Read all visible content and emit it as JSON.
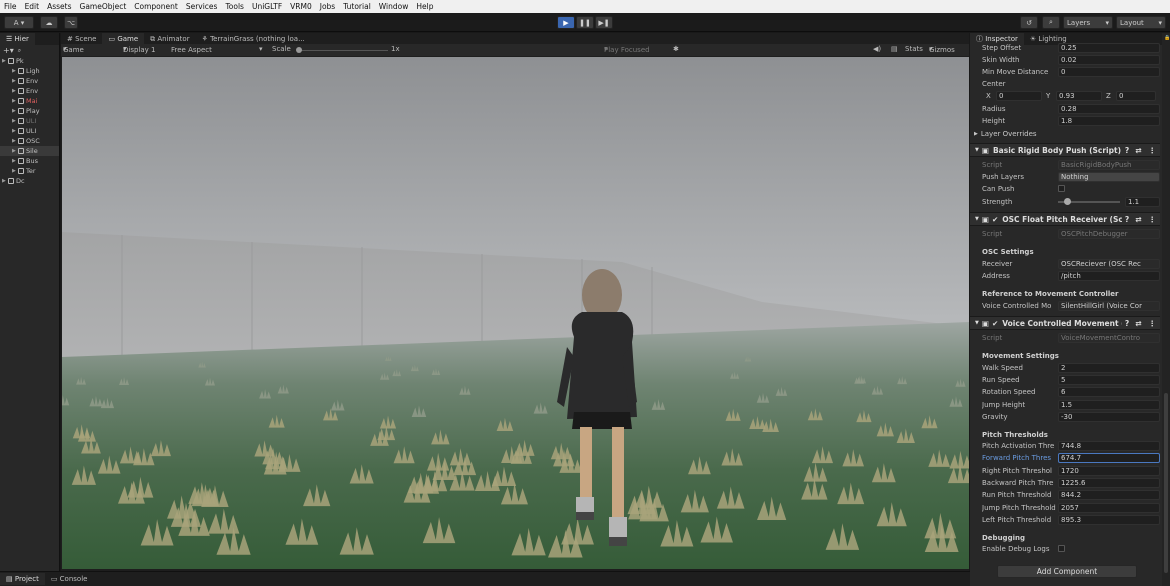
{
  "menu": [
    "File",
    "Edit",
    "Assets",
    "GameObject",
    "Component",
    "Services",
    "Tools",
    "UniGLTF",
    "VRM0",
    "Jobs",
    "Tutorial",
    "Window",
    "Help"
  ],
  "toolbar": {
    "account": "A ▾",
    "layers": "Layers",
    "layout": "Layout"
  },
  "hierarchy": {
    "tab": "Hier",
    "items": [
      {
        "label": "Pk",
        "indent": 0,
        "style": "normal"
      },
      {
        "label": "Ligh",
        "indent": 1,
        "style": "normal"
      },
      {
        "label": "Env",
        "indent": 1,
        "style": "normal"
      },
      {
        "label": "Env",
        "indent": 1,
        "style": "normal"
      },
      {
        "label": "Mai",
        "indent": 1,
        "style": "red"
      },
      {
        "label": "Play",
        "indent": 1,
        "style": "normal"
      },
      {
        "label": "ULI",
        "indent": 1,
        "style": "dim"
      },
      {
        "label": "ULI",
        "indent": 1,
        "style": "normal"
      },
      {
        "label": "OSC",
        "indent": 1,
        "style": "normal"
      },
      {
        "label": "Sile",
        "indent": 1,
        "style": "hl"
      },
      {
        "label": "Bus",
        "indent": 1,
        "style": "normal"
      },
      {
        "label": "Ter",
        "indent": 1,
        "style": "normal"
      },
      {
        "label": "Dc",
        "indent": 0,
        "style": "normal"
      }
    ]
  },
  "center_tabs": [
    "Scene",
    "Game",
    "Animator",
    "TerrainGrass (nothing loa..."
  ],
  "gamebar": {
    "mode": "Game",
    "display": "Display 1",
    "aspect": "Free Aspect",
    "scale_label": "Scale",
    "scale_value": "1x",
    "play_focused": "Play Focused",
    "stats": "Stats",
    "gizmos": "Gizmos"
  },
  "inspector_tabs": [
    "Inspector",
    "Lighting"
  ],
  "capsule": {
    "step_offset": {
      "label": "Step Offset",
      "value": "0.25"
    },
    "skin_width": {
      "label": "Skin Width",
      "value": "0.02"
    },
    "min_move": {
      "label": "Min Move Distance",
      "value": "0"
    },
    "center_label": "Center",
    "center": {
      "x_label": "X",
      "x": "0",
      "y_label": "Y",
      "y": "0.93",
      "z_label": "Z",
      "z": "0"
    },
    "radius": {
      "label": "Radius",
      "value": "0.28"
    },
    "height": {
      "label": "Height",
      "value": "1.8"
    },
    "layer_overrides": "Layer Overrides"
  },
  "push": {
    "title": "Basic Rigid Body Push (Script)",
    "script": {
      "label": "Script",
      "value": "BasicRigidBodyPush"
    },
    "push_layers": {
      "label": "Push Layers",
      "value": "Nothing"
    },
    "can_push": {
      "label": "Can Push"
    },
    "strength": {
      "label": "Strength",
      "value": "1.1",
      "fraction": 0.11
    }
  },
  "osc": {
    "title": "OSC Float Pitch Receiver (Script",
    "script": {
      "label": "Script",
      "value": "OSCPitchDebugger"
    },
    "settings_header": "OSC Settings",
    "receiver": {
      "label": "Receiver",
      "value": "OSCReciever (OSC Rec"
    },
    "address": {
      "label": "Address",
      "value": "/pitch"
    },
    "ref_header": "Reference to Movement Controller",
    "voice": {
      "label": "Voice Controlled Mo",
      "value": "SilentHillGirl (Voice Cor"
    }
  },
  "vcm": {
    "title": "Voice Controlled Movement (Sc",
    "script": {
      "label": "Script",
      "value": "VoiceMovementContro"
    },
    "movement_header": "Movement Settings",
    "walk": {
      "label": "Walk Speed",
      "value": "2"
    },
    "run": {
      "label": "Run Speed",
      "value": "5"
    },
    "rotation": {
      "label": "Rotation Speed",
      "value": "6"
    },
    "jump": {
      "label": "Jump Height",
      "value": "1.5"
    },
    "gravity": {
      "label": "Gravity",
      "value": "-30"
    },
    "pitch_header": "Pitch Thresholds",
    "pitch_activation": {
      "label": "Pitch Activation Thre",
      "value": "744.8"
    },
    "forward_pitch": {
      "label": "Forward Pitch Thres",
      "value": "674.7"
    },
    "right_pitch": {
      "label": "Right Pitch Threshol",
      "value": "1720"
    },
    "backward_pitch": {
      "label": "Backward Pitch Thre",
      "value": "1225.6"
    },
    "run_pitch": {
      "label": "Run Pitch Threshold",
      "value": "844.2"
    },
    "jump_pitch": {
      "label": "Jump Pitch Threshold",
      "value": "2057"
    },
    "left_pitch": {
      "label": "Left Pitch Threshold",
      "value": "895.3"
    },
    "debug_header": "Debugging",
    "debug_logs": {
      "label": "Enable Debug Logs"
    }
  },
  "add_component": "Add Component",
  "bottom_tabs": [
    "Project",
    "Console"
  ]
}
